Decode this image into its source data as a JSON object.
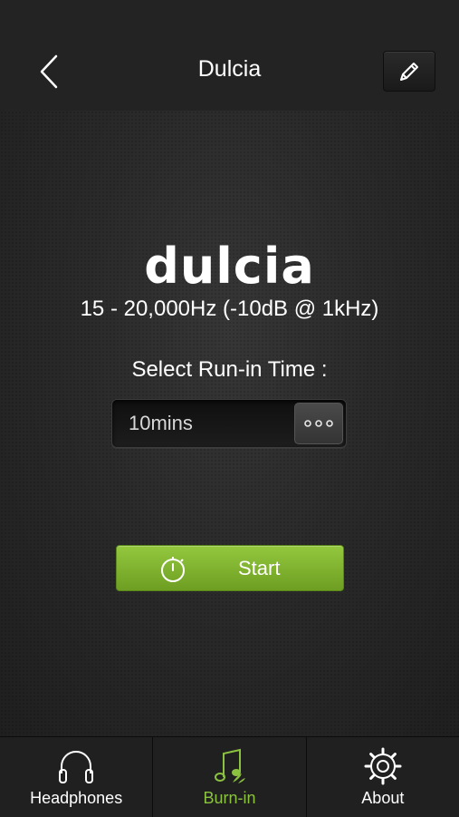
{
  "header": {
    "title": "Dulcia"
  },
  "product": {
    "brand": "dulcia",
    "spec": "15 - 20,000Hz (-10dB @ 1kHz)"
  },
  "runin": {
    "label": "Select Run-in Time :",
    "selected_value": "10mins",
    "more_label": "ooo"
  },
  "start_button": {
    "label": "Start"
  },
  "tabs": [
    {
      "label": "Headphones",
      "icon": "headphones-icon",
      "active": false
    },
    {
      "label": "Burn-in",
      "icon": "music-note-icon",
      "active": true
    },
    {
      "label": "About",
      "icon": "gear-icon",
      "active": false
    }
  ],
  "colors": {
    "accent": "#8bc240",
    "start_button": "#7fb130",
    "background": "#1c1c1c"
  }
}
